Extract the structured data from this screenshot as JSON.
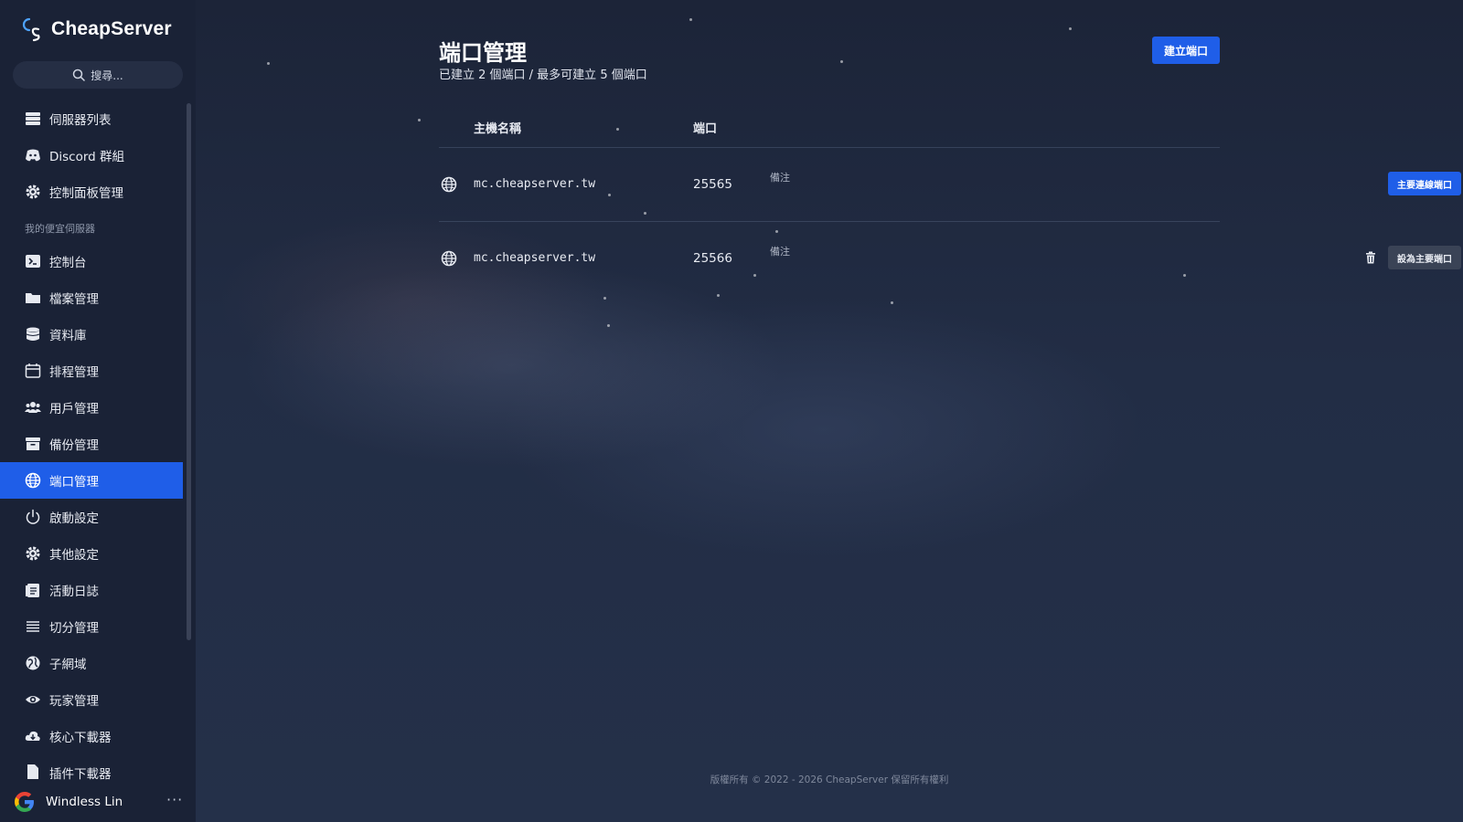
{
  "brand": {
    "name": "CheapServer"
  },
  "search": {
    "placeholder": "搜尋..."
  },
  "sidebar": {
    "top_items": [
      {
        "label": "伺服器列表",
        "icon": "server-icon"
      },
      {
        "label": "Discord 群組",
        "icon": "discord-icon"
      },
      {
        "label": "控制面板管理",
        "icon": "gear-icon"
      }
    ],
    "section_label": "我的便宜伺服器",
    "items": [
      {
        "label": "控制台",
        "icon": "terminal-icon"
      },
      {
        "label": "檔案管理",
        "icon": "folder-icon"
      },
      {
        "label": "資料庫",
        "icon": "database-icon"
      },
      {
        "label": "排程管理",
        "icon": "calendar-icon"
      },
      {
        "label": "用戶管理",
        "icon": "users-icon"
      },
      {
        "label": "備份管理",
        "icon": "archive-icon"
      },
      {
        "label": "端口管理",
        "icon": "globe-icon",
        "active": true
      },
      {
        "label": "啟動設定",
        "icon": "power-icon"
      },
      {
        "label": "其他設定",
        "icon": "gear-icon"
      },
      {
        "label": "活動日誌",
        "icon": "clipboard-icon"
      },
      {
        "label": "切分管理",
        "icon": "list-icon"
      },
      {
        "label": "子網域",
        "icon": "globe-network-icon"
      },
      {
        "label": "玩家管理",
        "icon": "eye-icon"
      },
      {
        "label": "核心下載器",
        "icon": "cloud-download-icon"
      },
      {
        "label": "插件下載器",
        "icon": "file-icon"
      }
    ]
  },
  "user": {
    "name": "Windless Lin",
    "more": "···"
  },
  "page": {
    "title": "端口管理",
    "subtitle": "已建立 2 個端口 / 最多可建立 5 個端口",
    "create_button": "建立端口"
  },
  "table": {
    "headers": {
      "host": "主機名稱",
      "port": "端口"
    },
    "rows": [
      {
        "host": "mc.cheapserver.tw",
        "port": "25565",
        "note": "備注",
        "action": "主要連線端口"
      },
      {
        "host": "mc.cheapserver.tw",
        "port": "25566",
        "note": "備注",
        "action": "設為主要端口"
      }
    ]
  },
  "footer": {
    "text": "版權所有 © 2022 - 2026 CheapServer 保留所有權利"
  },
  "colors": {
    "accent": "#1f5ee8",
    "sidebar_bg": "#1a2236",
    "secondary_button": "#3a4356"
  }
}
